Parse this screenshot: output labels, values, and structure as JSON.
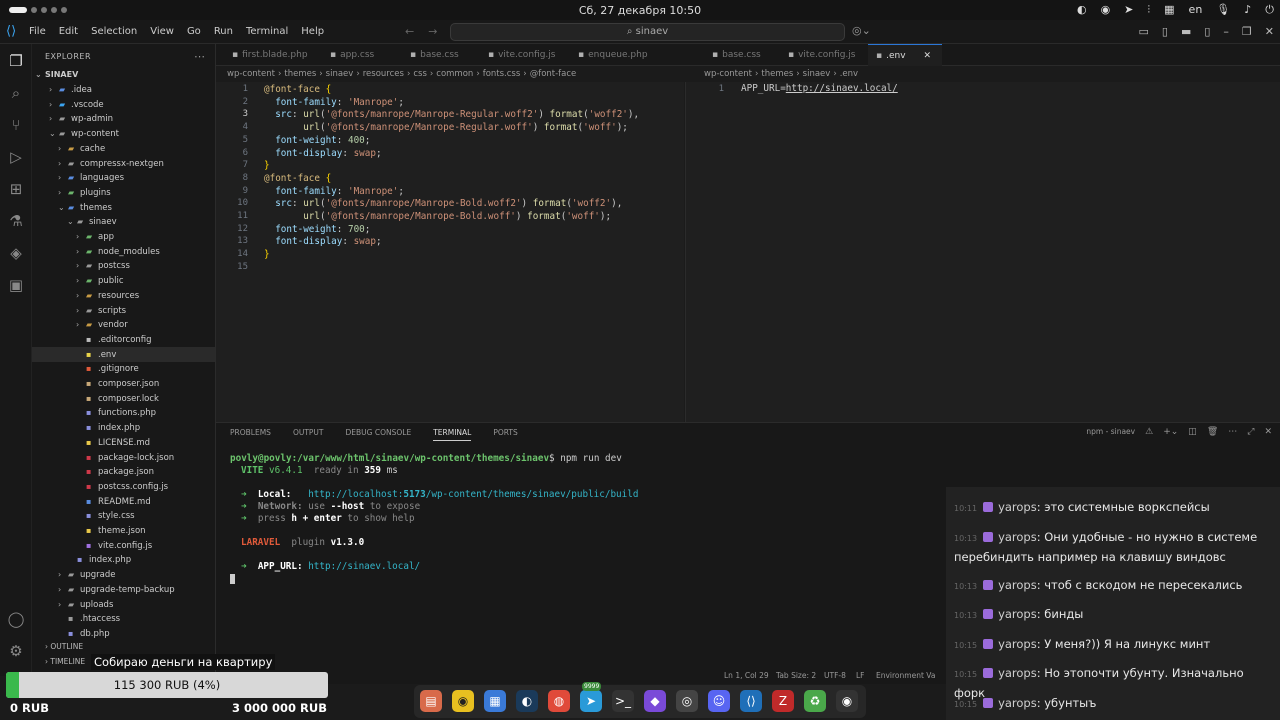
{
  "topbar": {
    "clock": "Сб, 27 декабря  10:50",
    "lang": "en"
  },
  "menu": [
    "File",
    "Edit",
    "Selection",
    "View",
    "Go",
    "Run",
    "Terminal",
    "Help"
  ],
  "search": {
    "text": "sinaev"
  },
  "explorer": {
    "title": "EXPLORER",
    "root": "SINAEV",
    "items": [
      {
        "label": ".idea",
        "depth": 1,
        "type": "folder",
        "color": "#5a8de0",
        "expanded": false
      },
      {
        "label": ".vscode",
        "depth": 1,
        "type": "folder",
        "color": "#3ba4f0",
        "expanded": false
      },
      {
        "label": "wp-admin",
        "depth": 1,
        "type": "folder",
        "color": "#9a9a9a",
        "expanded": false
      },
      {
        "label": "wp-content",
        "depth": 1,
        "type": "folder",
        "color": "#9a9a9a",
        "expanded": true
      },
      {
        "label": "cache",
        "depth": 2,
        "type": "folder",
        "color": "#c89b45",
        "expanded": false
      },
      {
        "label": "compressx-nextgen",
        "depth": 2,
        "type": "folder",
        "color": "#9a9a9a",
        "expanded": false
      },
      {
        "label": "languages",
        "depth": 2,
        "type": "folder",
        "color": "#5a8de0",
        "expanded": false
      },
      {
        "label": "plugins",
        "depth": 2,
        "type": "folder",
        "color": "#6cb56c",
        "expanded": false
      },
      {
        "label": "themes",
        "depth": 2,
        "type": "folder",
        "color": "#5a8de0",
        "expanded": true
      },
      {
        "label": "sinaev",
        "depth": 3,
        "type": "folder",
        "color": "#9a9a9a",
        "expanded": true
      },
      {
        "label": "app",
        "depth": 4,
        "type": "folder",
        "color": "#6cb56c",
        "expanded": false
      },
      {
        "label": "node_modules",
        "depth": 4,
        "type": "folder",
        "color": "#6cb56c",
        "expanded": false
      },
      {
        "label": "postcss",
        "depth": 4,
        "type": "folder",
        "color": "#9a9a9a",
        "expanded": false
      },
      {
        "label": "public",
        "depth": 4,
        "type": "folder",
        "color": "#6cb56c",
        "expanded": false
      },
      {
        "label": "resources",
        "depth": 4,
        "type": "folder",
        "color": "#c89b45",
        "expanded": false
      },
      {
        "label": "scripts",
        "depth": 4,
        "type": "folder",
        "color": "#9a9a9a",
        "expanded": false
      },
      {
        "label": "vendor",
        "depth": 4,
        "type": "folder",
        "color": "#c89b45",
        "expanded": false
      },
      {
        "label": ".editorconfig",
        "depth": 4,
        "type": "file",
        "color": "#bbbbbb",
        "expanded": false
      },
      {
        "label": ".env",
        "depth": 4,
        "type": "file",
        "color": "#e8d34a",
        "expanded": false
      },
      {
        "label": ".gitignore",
        "depth": 4,
        "type": "file",
        "color": "#e05a3a",
        "expanded": false
      },
      {
        "label": "composer.json",
        "depth": 4,
        "type": "file",
        "color": "#c8a878",
        "expanded": false
      },
      {
        "label": "composer.lock",
        "depth": 4,
        "type": "file",
        "color": "#c8a878",
        "expanded": false
      },
      {
        "label": "functions.php",
        "depth": 4,
        "type": "file",
        "color": "#8a8fdc",
        "expanded": false
      },
      {
        "label": "index.php",
        "depth": 4,
        "type": "file",
        "color": "#8a8fdc",
        "expanded": false
      },
      {
        "label": "LICENSE.md",
        "depth": 4,
        "type": "file",
        "color": "#e8c84a",
        "expanded": false
      },
      {
        "label": "package-lock.json",
        "depth": 4,
        "type": "file",
        "color": "#d0394a",
        "expanded": false
      },
      {
        "label": "package.json",
        "depth": 4,
        "type": "file",
        "color": "#d0394a",
        "expanded": false
      },
      {
        "label": "postcss.config.js",
        "depth": 4,
        "type": "file",
        "color": "#d0394a",
        "expanded": false
      },
      {
        "label": "README.md",
        "depth": 4,
        "type": "file",
        "color": "#5a8de0",
        "expanded": false
      },
      {
        "label": "style.css",
        "depth": 4,
        "type": "file",
        "color": "#8a8fdc",
        "expanded": false
      },
      {
        "label": "theme.json",
        "depth": 4,
        "type": "file",
        "color": "#e8c84a",
        "expanded": false
      },
      {
        "label": "vite.config.js",
        "depth": 4,
        "type": "file",
        "color": "#a070e0",
        "expanded": false
      },
      {
        "label": "index.php",
        "depth": 3,
        "type": "file",
        "color": "#8a8fdc",
        "expanded": false
      },
      {
        "label": "upgrade",
        "depth": 2,
        "type": "folder",
        "color": "#9a9a9a",
        "expanded": false
      },
      {
        "label": "upgrade-temp-backup",
        "depth": 2,
        "type": "folder",
        "color": "#9a9a9a",
        "expanded": false
      },
      {
        "label": "uploads",
        "depth": 2,
        "type": "folder",
        "color": "#9a9a9a",
        "expanded": false
      },
      {
        "label": ".htaccess",
        "depth": 2,
        "type": "file",
        "color": "#9a9a9a",
        "expanded": false
      },
      {
        "label": "db.php",
        "depth": 2,
        "type": "file",
        "color": "#8a8fdc",
        "expanded": false
      }
    ],
    "outline": "OUTLINE",
    "timeline": "TIMELINE"
  },
  "tabs": [
    {
      "label": "first.blade.php",
      "active": false
    },
    {
      "label": "app.css",
      "active": false
    },
    {
      "label": "base.css",
      "active": false
    },
    {
      "label": "vite.config.js",
      "active": false
    },
    {
      "label": "enqueue.php",
      "active": false
    },
    {
      "label": "base.css",
      "active": false
    },
    {
      "label": "vite.config.js",
      "active": false
    },
    {
      "label": ".env",
      "active": true
    }
  ],
  "breadcrumb1": [
    "wp-content",
    "themes",
    "sinaev",
    "resources",
    "css",
    "common",
    "fonts.css",
    "@font-face"
  ],
  "breadcrumb2": [
    "wp-content",
    "themes",
    "sinaev",
    ".env"
  ],
  "editor1": {
    "lines": [
      "1",
      "2",
      "3",
      "4",
      "5",
      "6",
      "7",
      "8",
      "9",
      "10",
      "11",
      "12",
      "13",
      "14",
      "15"
    ]
  },
  "editor2": {
    "line": "1",
    "key": "APP_URL",
    "eq": "=",
    "value": "http://sinaev.local/"
  },
  "panel": {
    "tabs": [
      "PROBLEMS",
      "OUTPUT",
      "DEBUG CONSOLE",
      "TERMINAL",
      "PORTS"
    ],
    "active": "TERMINAL",
    "terminal_name": "npm - sinaev"
  },
  "terminal": {
    "prompt": "povly@povly:/var/www/html/sinaev/wp-content/themes/sinaev",
    "command": "$ npm run dev",
    "vite": "VITE",
    "vite_ver": "v6.4.1",
    "ready": "ready in",
    "ready_ms": "359",
    "ms": "ms",
    "local_label": "Local:",
    "local_url_a": "http://localhost:",
    "local_port": "5173",
    "local_url_b": "/wp-content/themes/sinaev/public/build",
    "network_label": "Network:",
    "network_text_a": "use",
    "network_flag": "--host",
    "network_text_b": "to expose",
    "help_a": "press",
    "help_key": "h + enter",
    "help_b": "to show help",
    "laravel": "LARAVEL",
    "plugin": "plugin",
    "plugin_ver": "v1.3.0",
    "app_url_label": "APP_URL:",
    "app_url": "http://sinaev.local/"
  },
  "status": {
    "position": "Ln 1, Col 29",
    "tab": "Tab Size: 2",
    "encoding": "UTF-8",
    "eol": "LF",
    "env": "Environment Va"
  },
  "chat": [
    {
      "time": "10:11",
      "user": "yarops",
      "text": "это системные воркспейсы"
    },
    {
      "time": "10:13",
      "user": "yarops",
      "text": "Они удобные - но нужно в системе перебиндить например на клавишу виндовс"
    },
    {
      "time": "10:13",
      "user": "yarops",
      "text": "чтоб с вскодом не пересекались"
    },
    {
      "time": "10:13",
      "user": "yarops",
      "text": "бинды"
    },
    {
      "time": "10:15",
      "user": "yarops",
      "text": "У меня?)) Я на линукс минт"
    },
    {
      "time": "10:15",
      "user": "yarops",
      "text": "Но этопочти убунту. Изначально форк"
    },
    {
      "time": "10:15",
      "user": "yarops",
      "text": "убунтыъ"
    }
  ],
  "donation": {
    "title": "Собираю деньги на квартиру",
    "current": "115 300 RUB (4%)",
    "progress": 0.04,
    "min": "0 RUB",
    "max": "3 000 000 RUB"
  },
  "dock": {
    "badge": "9999"
  }
}
